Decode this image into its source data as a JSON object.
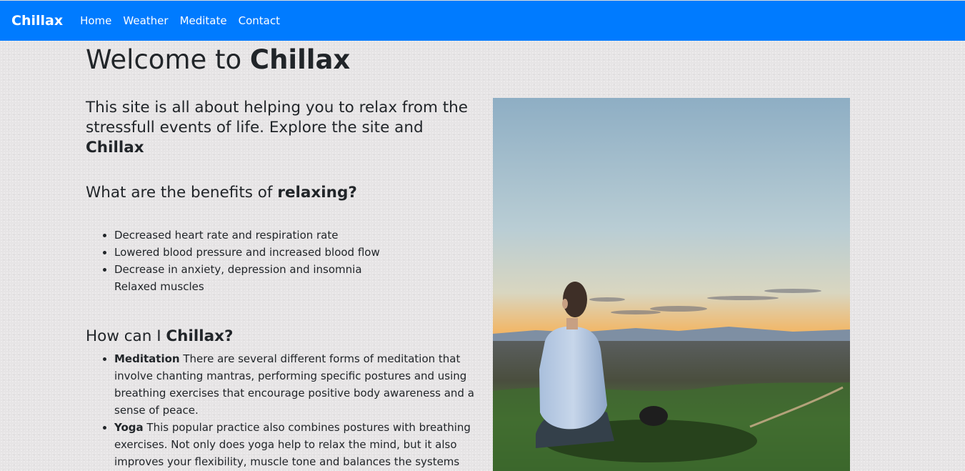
{
  "navbar": {
    "brand": "Chillax",
    "links": [
      "Home",
      "Weather",
      "Meditate",
      "Contact"
    ]
  },
  "main": {
    "title_prefix": "Welcome to ",
    "title_bold": "Chillax",
    "intro_text": "This site is all about helping you to relax from the stressfull events of life. Explore the site and ",
    "intro_bold": "Chillax",
    "benefits_heading_prefix": "What are the benefits of ",
    "benefits_heading_bold": "relaxing?",
    "benefits": [
      "Decreased heart rate and respiration rate",
      "Lowered blood pressure and increased blood flow",
      "Decrease in anxiety, depression and insomnia",
      "Relaxed muscles"
    ],
    "how_heading_prefix": "How can I ",
    "how_heading_bold": "Chillax?",
    "how_items": [
      {
        "term": "Meditation",
        "text": " There are several different forms of meditation that involve chanting mantras, performing specific postures and using breathing exercises that encourage positive body awareness and a sense of peace."
      },
      {
        "term": "Yoga",
        "text": " This popular practice also combines postures with breathing exercises. Not only does yoga help to relax the mind, but it also improves your flexibility, muscle tone and balances the systems within"
      }
    ]
  },
  "colors": {
    "navbar": "#007bff",
    "background": "#e6e4e5",
    "text": "#212529"
  }
}
